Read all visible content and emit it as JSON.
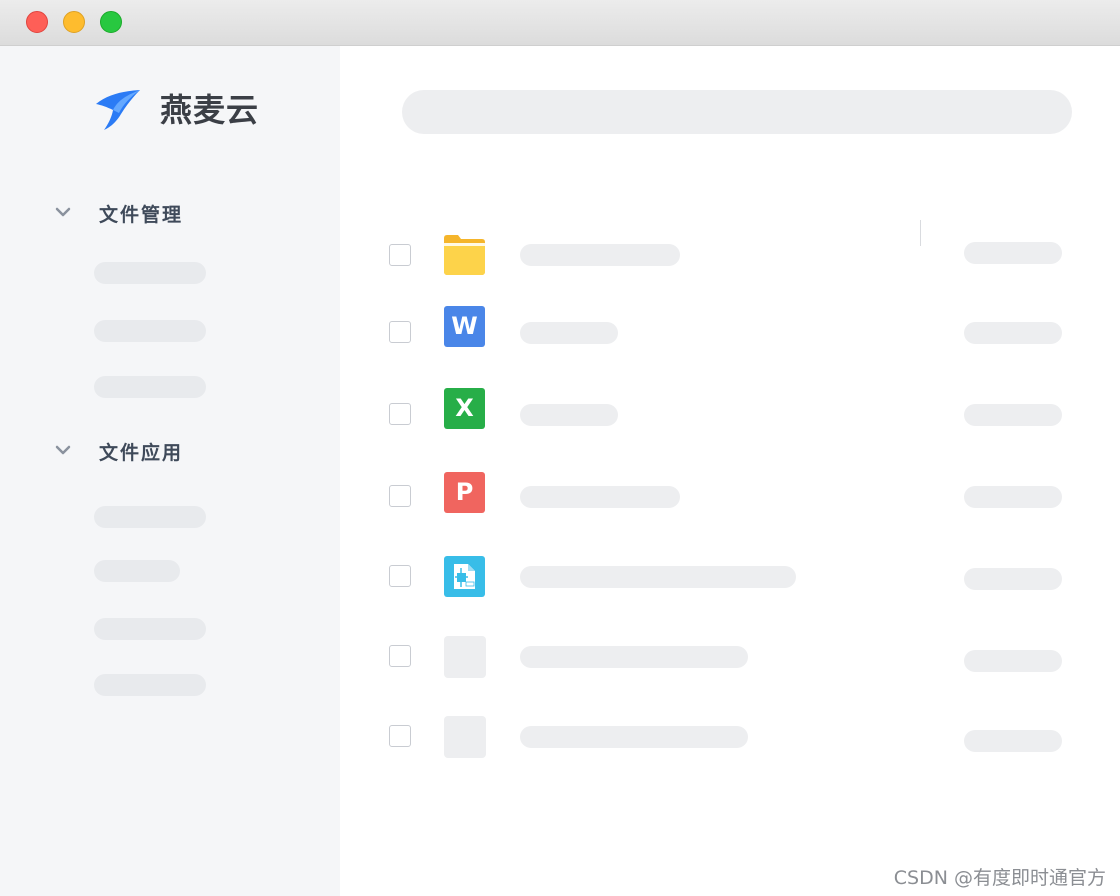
{
  "window": {
    "controls": [
      {
        "name": "close",
        "color": "#fe5f57"
      },
      {
        "name": "minimize",
        "color": "#febc2e"
      },
      {
        "name": "maximize",
        "color": "#28c840"
      }
    ]
  },
  "sidebar": {
    "brand": "燕麦云",
    "logo_icon": "swallow-logo-icon",
    "accent_color": "#2b7bf5",
    "sections": [
      {
        "label": "文件管理",
        "icon": "chevron-down-icon"
      },
      {
        "label": "文件应用",
        "icon": "chevron-down-icon"
      }
    ]
  },
  "files": [
    {
      "type": "folder",
      "icon": "folder-icon",
      "color": "#fbc02d"
    },
    {
      "type": "word",
      "icon": "word-doc-icon",
      "glyph": "W",
      "color": "#4a86e8"
    },
    {
      "type": "excel",
      "icon": "excel-sheet-icon",
      "glyph": "X",
      "color": "#27ae48"
    },
    {
      "type": "powerpoint",
      "icon": "ppt-slide-icon",
      "glyph": "P",
      "color": "#f0655f"
    },
    {
      "type": "cad",
      "icon": "cad-file-icon",
      "color": "#38bde8"
    },
    {
      "type": "unknown",
      "icon": "placeholder-file-icon",
      "color": "#edeef0"
    },
    {
      "type": "unknown",
      "icon": "placeholder-file-icon",
      "color": "#edeef0"
    }
  ],
  "watermark": "CSDN @有度即时通官方"
}
